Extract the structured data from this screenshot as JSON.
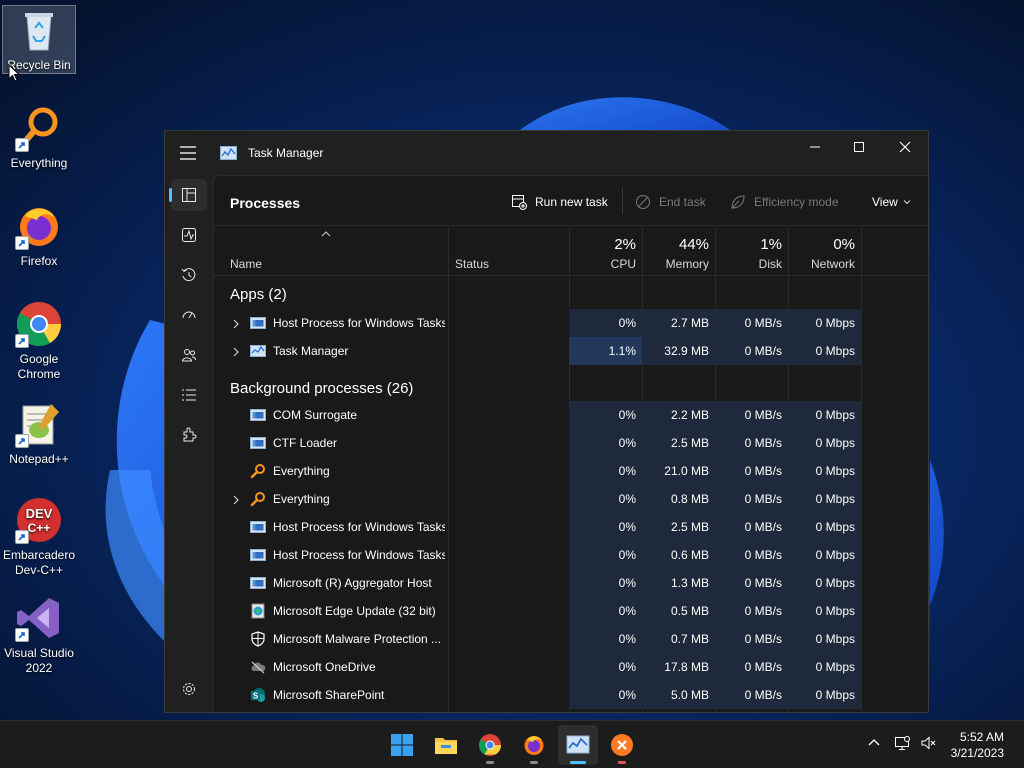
{
  "desktop": {
    "icons": [
      {
        "label": "Recycle Bin",
        "icon": "recycle-bin-icon"
      },
      {
        "label": "Everything",
        "icon": "everything-icon"
      },
      {
        "label": "Firefox",
        "icon": "firefox-icon"
      },
      {
        "label": "Google Chrome",
        "icon": "chrome-icon"
      },
      {
        "label": "Notepad++",
        "icon": "notepadpp-icon"
      },
      {
        "label": "Embarcadero Dev-C++",
        "icon": "devcpp-icon"
      },
      {
        "label": "Visual Studio 2022",
        "icon": "visual-studio-icon"
      }
    ]
  },
  "window": {
    "title": "Task Manager",
    "page_title": "Processes",
    "toolbar": {
      "run_new_task": "Run new task",
      "end_task": "End task",
      "efficiency_mode": "Efficiency mode",
      "view": "View"
    },
    "nav": [
      "processes-icon",
      "performance-icon",
      "app-history-icon",
      "startup-apps-icon",
      "users-icon",
      "details-icon",
      "services-icon",
      "settings-icon"
    ]
  },
  "columns": {
    "name": "Name",
    "status": "Status",
    "cpu": {
      "percent": "2%",
      "label": "CPU"
    },
    "memory": {
      "percent": "44%",
      "label": "Memory"
    },
    "disk": {
      "percent": "1%",
      "label": "Disk"
    },
    "network": {
      "percent": "0%",
      "label": "Network"
    }
  },
  "groups": {
    "apps": "Apps (2)",
    "background": "Background processes (26)"
  },
  "apps": [
    {
      "name": "Host Process for Windows Tasks",
      "expandable": true,
      "icon": "window-process-icon",
      "cpu": "0%",
      "memory": "2.7 MB",
      "disk": "0 MB/s",
      "network": "0 Mbps"
    },
    {
      "name": "Task Manager",
      "expandable": true,
      "icon": "task-manager-icon",
      "cpu": "1.1%",
      "memory": "32.9 MB",
      "disk": "0 MB/s",
      "network": "0 Mbps"
    }
  ],
  "background": [
    {
      "name": "COM Surrogate",
      "expandable": false,
      "icon": "window-process-icon",
      "cpu": "0%",
      "memory": "2.2 MB",
      "disk": "0 MB/s",
      "network": "0 Mbps"
    },
    {
      "name": "CTF Loader",
      "expandable": false,
      "icon": "window-process-icon",
      "cpu": "0%",
      "memory": "2.5 MB",
      "disk": "0 MB/s",
      "network": "0 Mbps"
    },
    {
      "name": "Everything",
      "expandable": false,
      "icon": "everything-icon",
      "cpu": "0%",
      "memory": "21.0 MB",
      "disk": "0 MB/s",
      "network": "0 Mbps"
    },
    {
      "name": "Everything",
      "expandable": true,
      "icon": "everything-icon",
      "cpu": "0%",
      "memory": "0.8 MB",
      "disk": "0 MB/s",
      "network": "0 Mbps"
    },
    {
      "name": "Host Process for Windows Tasks",
      "expandable": false,
      "icon": "window-process-icon",
      "cpu": "0%",
      "memory": "2.5 MB",
      "disk": "0 MB/s",
      "network": "0 Mbps"
    },
    {
      "name": "Host Process for Windows Tasks",
      "expandable": false,
      "icon": "window-process-icon",
      "cpu": "0%",
      "memory": "0.6 MB",
      "disk": "0 MB/s",
      "network": "0 Mbps"
    },
    {
      "name": "Microsoft (R) Aggregator Host",
      "expandable": false,
      "icon": "window-process-icon",
      "cpu": "0%",
      "memory": "1.3 MB",
      "disk": "0 MB/s",
      "network": "0 Mbps"
    },
    {
      "name": "Microsoft Edge Update (32 bit)",
      "expandable": false,
      "icon": "edge-update-icon",
      "cpu": "0%",
      "memory": "0.5 MB",
      "disk": "0 MB/s",
      "network": "0 Mbps"
    },
    {
      "name": "Microsoft Malware Protection ...",
      "expandable": false,
      "icon": "shield-icon",
      "cpu": "0%",
      "memory": "0.7 MB",
      "disk": "0 MB/s",
      "network": "0 Mbps"
    },
    {
      "name": "Microsoft OneDrive",
      "expandable": false,
      "icon": "onedrive-icon",
      "cpu": "0%",
      "memory": "17.8 MB",
      "disk": "0 MB/s",
      "network": "0 Mbps"
    },
    {
      "name": "Microsoft SharePoint",
      "expandable": false,
      "icon": "sharepoint-icon",
      "cpu": "0%",
      "memory": "5.0 MB",
      "disk": "0 MB/s",
      "network": "0 Mbps"
    }
  ],
  "taskbar": {
    "apps": [
      "start-icon",
      "file-explorer-icon",
      "chrome-icon",
      "firefox-icon",
      "task-manager-icon",
      "xampp-icon"
    ],
    "time": "5:52 AM",
    "date": "3/21/2023"
  },
  "colors": {
    "accent": "#4cc2ff",
    "heat_light": "#1e2a3b",
    "heat_dark": "#22385a",
    "window_bg": "#202020"
  }
}
